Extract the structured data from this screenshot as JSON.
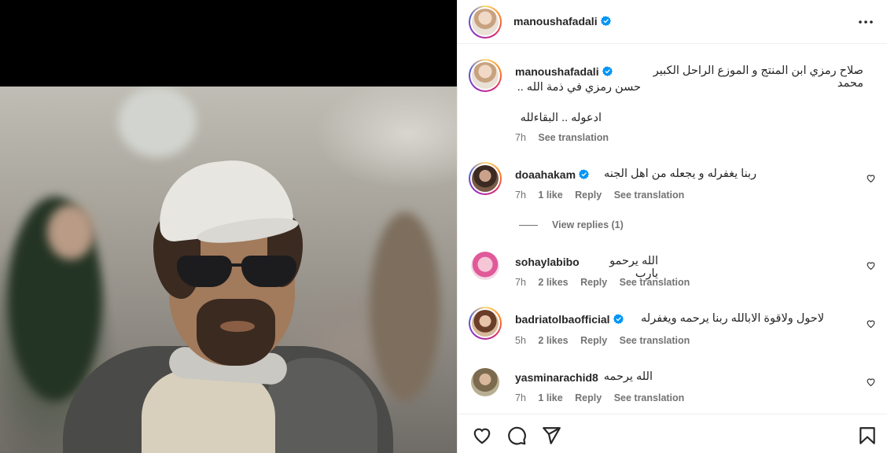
{
  "post": {
    "author": "manoushafadali",
    "more_icon": "more-horizontal-icon"
  },
  "caption": {
    "author": "manoushafadali",
    "line1": "صلاح رمزي ابن المنتج و الموزع الراحل الكبير محمد",
    "line2": "حسن رمزي في ذمة الله ..",
    "line3": "ادعوله .. البقاءلله",
    "time": "7h",
    "see_translation": "See translation"
  },
  "comments": [
    {
      "user": "doaahakam",
      "verified": true,
      "text": "ربنا يغفرله و يجعله من اهل الجنه",
      "time": "7h",
      "likes": "1 like",
      "reply": "Reply",
      "see_translation": "See translation",
      "view_replies": "View replies (1)"
    },
    {
      "user": "sohaylabibo",
      "verified": false,
      "text": "الله يرحمو يارب",
      "time": "7h",
      "likes": "2 likes",
      "reply": "Reply",
      "see_translation": "See translation"
    },
    {
      "user": "badriatolbaofficial",
      "verified": true,
      "text": "لاحول ولاقوة الابالله ربنا يرحمه ويغفرله",
      "time": "5h",
      "likes": "2 likes",
      "reply": "Reply",
      "see_translation": "See translation"
    },
    {
      "user": "yasminarachid8",
      "verified": false,
      "text": "الله يرحمه",
      "time": "7h",
      "likes": "1 like",
      "reply": "Reply",
      "see_translation": "See translation"
    }
  ],
  "actions": {
    "like_icon": "heart-icon",
    "comment_icon": "comment-icon",
    "share_icon": "send-icon",
    "save_icon": "bookmark-icon"
  },
  "colors": {
    "verified": "#0095f6",
    "muted_text": "#737373",
    "primary_text": "#262626"
  }
}
